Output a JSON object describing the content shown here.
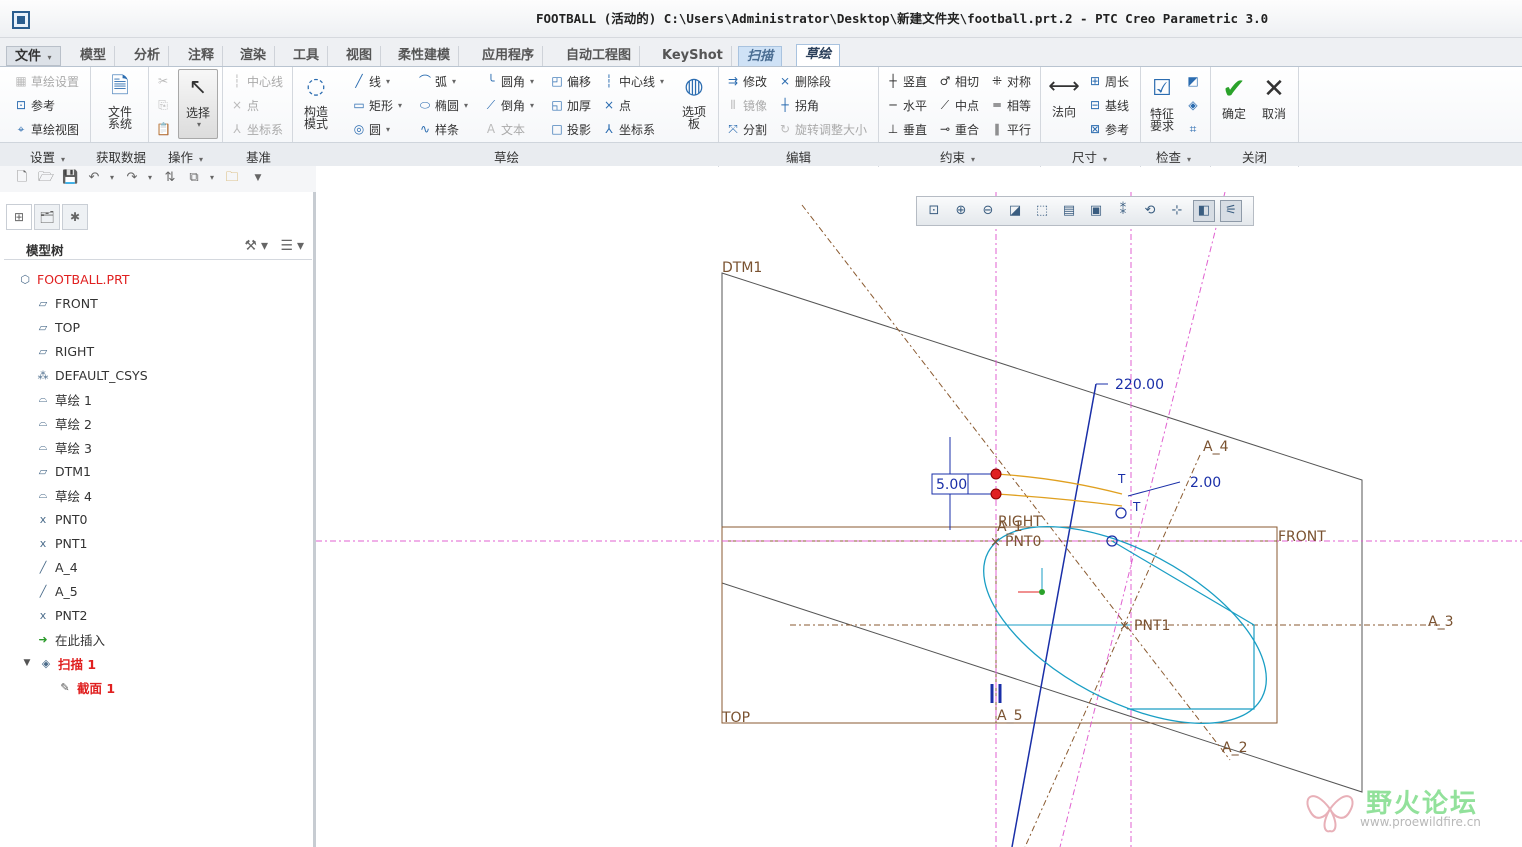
{
  "window": {
    "title": "FOOTBALL (活动的) C:\\Users\\Administrator\\Desktop\\新建文件夹\\football.prt.2 - PTC Creo Parametric 3.0"
  },
  "tabs": [
    {
      "label": "文件"
    },
    {
      "label": "模型"
    },
    {
      "label": "分析"
    },
    {
      "label": "注释"
    },
    {
      "label": "渲染"
    },
    {
      "label": "工具"
    },
    {
      "label": "视图"
    },
    {
      "label": "柔性建模"
    },
    {
      "label": "应用程序"
    },
    {
      "label": "自动工程图"
    },
    {
      "label": "KeyShot"
    },
    {
      "label": "扫描"
    },
    {
      "label": "草绘"
    }
  ],
  "ribbon": {
    "setup": {
      "sketch_setup": "草绘设置",
      "reference": "参考",
      "sketch_view": "草绘视图"
    },
    "get_data": {
      "file_system": "文件系统"
    },
    "operations": {
      "select": "选择"
    },
    "datum": {
      "centerline": "中心线",
      "point": "点",
      "csys": "坐标系"
    },
    "construction": {
      "label": "构造模式"
    },
    "sketch": {
      "line": "线",
      "rectangle": "矩形",
      "circle": "圆",
      "arc": "弧",
      "ellipse": "椭圆",
      "spline": "样条",
      "fillet": "圆角",
      "chamfer": "倒角",
      "text": "文本",
      "offset": "偏移",
      "thicken": "加厚",
      "project": "投影",
      "centerline": "中心线",
      "point": "点",
      "csys": "坐标系",
      "palette": "选项板"
    },
    "edit": {
      "modify": "修改",
      "mirror": "镜像",
      "divide": "分割",
      "delete_segment": "删除段",
      "corner": "拐角",
      "rotate_resize": "旋转调整大小"
    },
    "constrain": {
      "vertical": "竖直",
      "horizontal": "水平",
      "perpendicular": "垂直",
      "tangent": "相切",
      "midpoint": "中点",
      "coincident": "重合",
      "symmetric": "对称",
      "equal": "相等",
      "parallel": "平行"
    },
    "dimension": {
      "normal": "法向",
      "perimeter": "周长",
      "baseline": "基线",
      "reference": "参考"
    },
    "inspect": {
      "feature_req": "特征要求"
    },
    "close": {
      "ok": "确定",
      "cancel": "取消"
    }
  },
  "groups": {
    "setup": "设置",
    "get_data": "获取数据",
    "operations": "操作",
    "datum": "基准",
    "sketch": "草绘",
    "edit": "编辑",
    "constrain": "约束",
    "dimension": "尺寸",
    "inspect": "检查",
    "close": "关闭"
  },
  "model_tree": {
    "header": "模型树",
    "nodes": [
      {
        "label": "FOOTBALL.PRT",
        "icon": "part-icon"
      },
      {
        "label": "FRONT",
        "icon": "datum-plane-icon"
      },
      {
        "label": "TOP",
        "icon": "datum-plane-icon"
      },
      {
        "label": "RIGHT",
        "icon": "datum-plane-icon"
      },
      {
        "label": "DEFAULT_CSYS",
        "icon": "csys-icon"
      },
      {
        "label": "草绘 1",
        "icon": "sketch-icon"
      },
      {
        "label": "草绘 2",
        "icon": "sketch-icon"
      },
      {
        "label": "草绘 3",
        "icon": "sketch-icon"
      },
      {
        "label": "DTM1",
        "icon": "datum-plane-icon"
      },
      {
        "label": "草绘 4",
        "icon": "sketch-icon"
      },
      {
        "label": "PNT0",
        "icon": "datum-point-icon"
      },
      {
        "label": "PNT1",
        "icon": "datum-point-icon"
      },
      {
        "label": "A_4",
        "icon": "axis-icon"
      },
      {
        "label": "A_5",
        "icon": "axis-icon"
      },
      {
        "label": "PNT2",
        "icon": "datum-point-icon"
      },
      {
        "label": "在此插入",
        "icon": "insert-arrow-icon"
      },
      {
        "label": "扫描 1",
        "icon": "sweep-icon"
      },
      {
        "label": "截面 1",
        "icon": "section-icon"
      }
    ]
  },
  "canvas": {
    "labels": {
      "dtm1": "DTM1",
      "right": "RIGHT",
      "front": "FRONT",
      "top": "TOP",
      "pnt0": "PNT0",
      "pnt1": "PNT1",
      "a2": "A_2",
      "a3": "A_3",
      "a4": "A_4",
      "a5": "A_5",
      "a1": "A_1",
      "t1": "T",
      "t2": "T"
    },
    "dimensions": {
      "length": "220.00",
      "offset": "5.00",
      "small": "2.00"
    }
  },
  "watermark": {
    "title": "野火论坛",
    "url": "www.proewildfire.cn"
  },
  "colors": {
    "dimension": "#1a2fa8",
    "datum": "#7a5230",
    "sketch": "#1a9ec4",
    "highlight": "#e0a020",
    "axis_magenta": "#e060d0"
  }
}
